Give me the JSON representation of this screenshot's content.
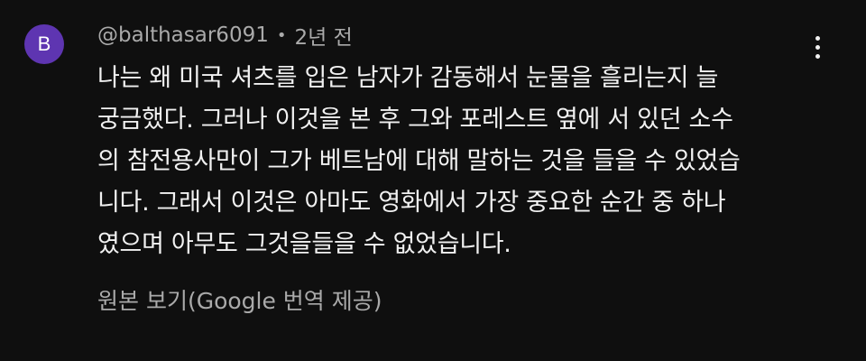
{
  "comment": {
    "avatar_letter": "B",
    "avatar_color": "#5e35b1",
    "author": "@balthasar6091",
    "separator": "•",
    "timestamp": "2년 전",
    "body_lines": [
      "나는 왜 미국 셔츠를 입은 남자가 감동해서 눈물을 흘리는지 늘",
      "궁금했다. 그러나 이것을 본 후 그와 포레스트 옆에 서 있던 소수",
      "의 참전용사만이 그가 베트남에 대해 말하는 것을 들을 수 있었습",
      "니다. 그래서 이것은 아마도 영화에서 가장 중요한 순간 중 하나",
      "였으며 아무도 그것을들을 수 없었습니다."
    ],
    "translate_link": "원본 보기(Google 번역 제공)",
    "menu_icon": "more-vert-icon"
  },
  "colors": {
    "background": "#0f0f0f",
    "text_primary": "#f1f1f1",
    "text_secondary": "#aaaaaa"
  }
}
